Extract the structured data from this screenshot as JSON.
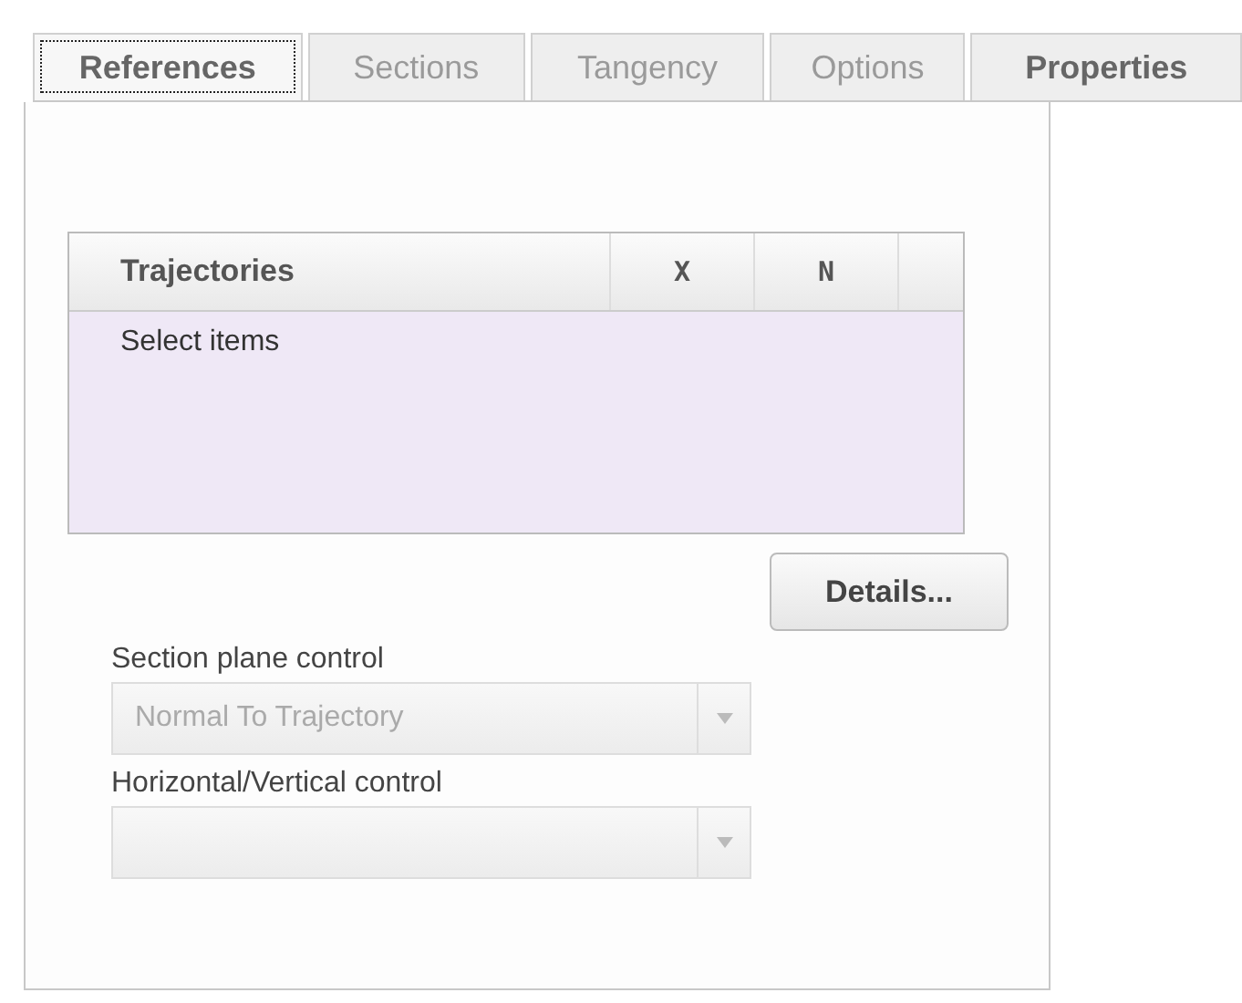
{
  "tabs": [
    {
      "label": "References",
      "selected": true,
      "disabled": false
    },
    {
      "label": "Sections",
      "selected": false,
      "disabled": true
    },
    {
      "label": "Tangency",
      "selected": false,
      "disabled": true
    },
    {
      "label": "Options",
      "selected": false,
      "disabled": true
    },
    {
      "label": "Properties",
      "selected": false,
      "disabled": false
    }
  ],
  "table": {
    "columns": [
      "Trajectories",
      "X",
      "N"
    ],
    "placeholder": "Select items"
  },
  "details_button": "Details...",
  "controls": [
    {
      "label": "Section plane control",
      "value": "Normal To Trajectory",
      "disabled": true
    },
    {
      "label": "Horizontal/Vertical control",
      "disabled": true
    }
  ]
}
